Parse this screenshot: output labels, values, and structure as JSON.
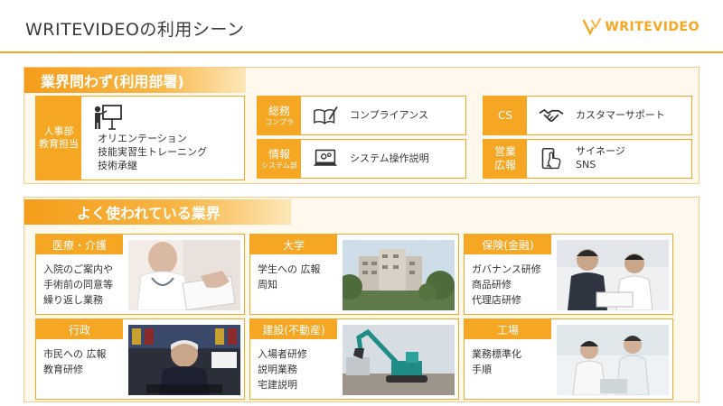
{
  "header": {
    "title": "WRITEVIDEOの利用シーン",
    "logo_text": "WRITEVIDEO"
  },
  "colors": {
    "accent": "#f5a623",
    "panel_bg": "#fff8ed"
  },
  "departments": {
    "heading": "業界問わず(利用部署)",
    "hr": {
      "tag_line1": "人事部",
      "tag_line2": "教育担当",
      "icon": "presentation-icon",
      "items": [
        "オリエンテーション",
        "技能実習生トレーニング",
        "技術承継"
      ]
    },
    "general": {
      "tag_line1": "総務",
      "tag_line2": "コンプラ",
      "icon": "book-pen-icon",
      "items": [
        "コンプライアンス"
      ]
    },
    "info": {
      "tag_line1": "情報",
      "tag_line2": "システム部",
      "icon": "laptop-gear-icon",
      "items": [
        "システム操作説明"
      ]
    },
    "cs": {
      "tag_line1": "CS",
      "icon": "handshake-icon",
      "items": [
        "カスタマーサポート"
      ]
    },
    "sales": {
      "tag_line1": "営業",
      "tag_line2": "広報",
      "icon": "phone-touch-icon",
      "items": [
        "サイネージ",
        "SNS"
      ]
    }
  },
  "industries": {
    "heading": "よく使われている業界",
    "medical": {
      "label": "医療・介護",
      "items": [
        "入院のご案内や",
        "手術前の同意等",
        "繰り返し業務"
      ]
    },
    "university": {
      "label": "大学",
      "items": [
        "学生への 広報",
        "周知"
      ]
    },
    "insurance": {
      "label": "保険(金融)",
      "items": [
        "ガバナンス研修",
        "商品研修",
        "代理店研修"
      ]
    },
    "government": {
      "label": "行政",
      "items": [
        "市民への 広報",
        "教育研修"
      ]
    },
    "construction": {
      "label": "建設(不動産)",
      "items": [
        "入場者研修",
        "説明業務",
        "宅建説明"
      ]
    },
    "factory": {
      "label": "工場",
      "items": [
        "業務標準化",
        "手順"
      ]
    }
  }
}
